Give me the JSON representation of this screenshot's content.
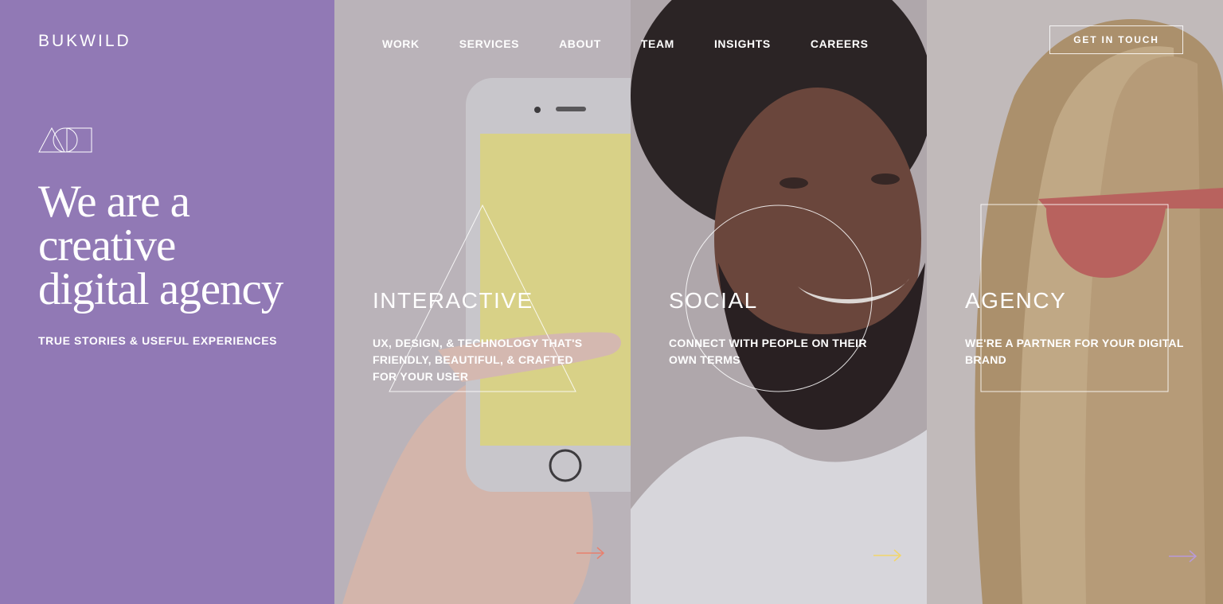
{
  "brand": {
    "logo": "BUKWILD",
    "accent": "#9179b5"
  },
  "nav": {
    "items": [
      {
        "label": "WORK"
      },
      {
        "label": "SERVICES"
      },
      {
        "label": "ABOUT"
      },
      {
        "label": "TEAM"
      },
      {
        "label": "INSIGHTS"
      },
      {
        "label": "CAREERS"
      }
    ],
    "cta_label": "GET IN TOUCH"
  },
  "intro": {
    "headline_line1": "We are a",
    "headline_line2": "creative",
    "headline_line3": "digital agency",
    "tagline": "TRUE STORIES & USEFUL EXPERIENCES",
    "mark_icon": "triangle-circle-square-icon"
  },
  "panels": [
    {
      "title": "INTERACTIVE",
      "desc_line1": "UX, DESIGN, & TECHNOLOGY THAT'S",
      "desc_line2": "FRIENDLY, BEAUTIFUL, & CRAFTED",
      "desc_line3": "FOR YOUR USER",
      "shape_icon": "triangle-outline-icon",
      "arrow_color": "#e8806e"
    },
    {
      "title": "SOCIAL",
      "desc_line1": "CONNECT WITH PEOPLE ON THEIR",
      "desc_line2": "OWN TERMS",
      "shape_icon": "circle-outline-icon",
      "arrow_color": "#f2d66a"
    },
    {
      "title": "AGENCY",
      "desc_line1": "WE'RE A PARTNER FOR YOUR DIGITAL",
      "desc_line2": "BRAND",
      "shape_icon": "square-outline-icon",
      "arrow_color": "#b89ad8"
    }
  ]
}
